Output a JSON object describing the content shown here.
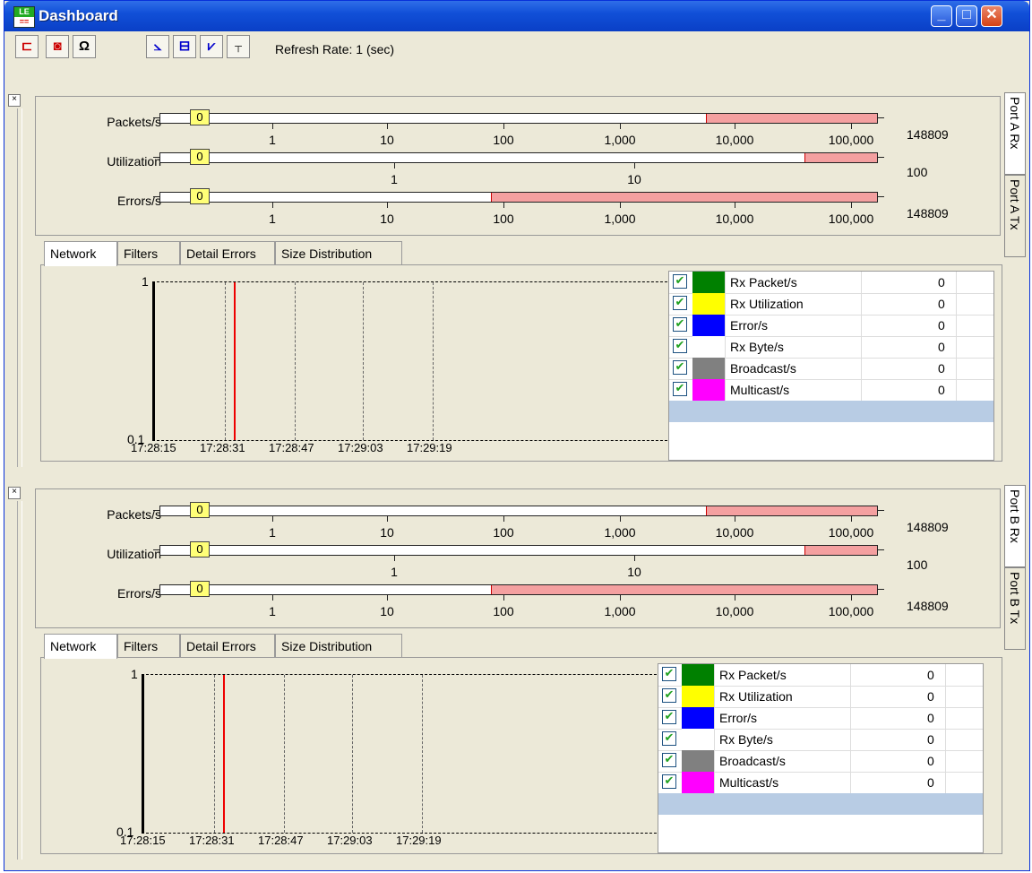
{
  "window": {
    "title": "Dashboard",
    "icon_text": "LE"
  },
  "toolbar": {
    "refresh_label": "Refresh Rate: 1 (sec)"
  },
  "panels": [
    {
      "side_tabs": [
        "Port A Rx",
        "Port A Tx"
      ],
      "meters": [
        {
          "label": "Packets/s",
          "value": "0",
          "max": "148809",
          "ticks": [
            "1",
            "10",
            "100",
            "1,000",
            "10,000",
            "100,000"
          ]
        },
        {
          "label": "Utilization",
          "value": "0",
          "max": "100",
          "ticks": [
            "1",
            "10"
          ]
        },
        {
          "label": "Errors/s",
          "value": "0",
          "max": "148809",
          "ticks": [
            "1",
            "10",
            "100",
            "1,000",
            "10,000",
            "100,000"
          ]
        }
      ],
      "tabs": [
        "Network",
        "Filters",
        "Detail Errors",
        "Size Distribution"
      ],
      "y_max": "1",
      "y_min": "0.1",
      "x_labels": [
        "17:28:15",
        "17:28:31",
        "17:28:47",
        "17:29:03",
        "17:29:19"
      ],
      "legend": [
        {
          "name": "Rx Packet/s",
          "value": "0",
          "color": "#008000"
        },
        {
          "name": "Rx Utilization",
          "value": "0",
          "color": "#ffff00"
        },
        {
          "name": "Error/s",
          "value": "0",
          "color": "#0000ff"
        },
        {
          "name": "Rx Byte/s",
          "value": "0",
          "color": "#ffffff"
        },
        {
          "name": "Broadcast/s",
          "value": "0",
          "color": "#808080"
        },
        {
          "name": "Multicast/s",
          "value": "0",
          "color": "#ff00ff"
        }
      ]
    },
    {
      "side_tabs": [
        "Port B Rx",
        "Port B Tx"
      ],
      "meters": [
        {
          "label": "Packets/s",
          "value": "0",
          "max": "148809",
          "ticks": [
            "1",
            "10",
            "100",
            "1,000",
            "10,000",
            "100,000"
          ]
        },
        {
          "label": "Utilization",
          "value": "0",
          "max": "100",
          "ticks": [
            "1",
            "10"
          ]
        },
        {
          "label": "Errors/s",
          "value": "0",
          "max": "148809",
          "ticks": [
            "1",
            "10",
            "100",
            "1,000",
            "10,000",
            "100,000"
          ]
        }
      ],
      "tabs": [
        "Network",
        "Filters",
        "Detail Errors",
        "Size Distribution"
      ],
      "y_max": "1",
      "y_min": "0.1",
      "x_labels": [
        "17:28:15",
        "17:28:31",
        "17:28:47",
        "17:29:03",
        "17:29:19"
      ],
      "legend": [
        {
          "name": "Rx Packet/s",
          "value": "0",
          "color": "#008000"
        },
        {
          "name": "Rx Utilization",
          "value": "0",
          "color": "#ffff00"
        },
        {
          "name": "Error/s",
          "value": "0",
          "color": "#0000ff"
        },
        {
          "name": "Rx Byte/s",
          "value": "0",
          "color": "#ffffff"
        },
        {
          "name": "Broadcast/s",
          "value": "0",
          "color": "#808080"
        },
        {
          "name": "Multicast/s",
          "value": "0",
          "color": "#ff00ff"
        }
      ]
    }
  ]
}
